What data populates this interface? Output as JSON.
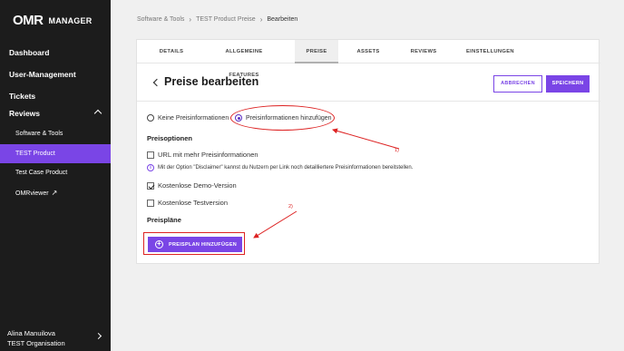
{
  "brand": {
    "mark": "OMR",
    "name": "MANAGER"
  },
  "sidebar": {
    "top_items": [
      {
        "label": "Dashboard"
      },
      {
        "label": "User-Management"
      },
      {
        "label": "Tickets"
      }
    ],
    "section": {
      "label": "Reviews"
    },
    "sub_items": [
      {
        "label": "Software & Tools"
      },
      {
        "label": "TEST Product",
        "active": true
      },
      {
        "label": "Test Case Product"
      },
      {
        "label": "OMRviewer"
      }
    ],
    "user": {
      "name": "Alina Manuilova",
      "org": "TEST Organisation"
    }
  },
  "breadcrumb": {
    "items": [
      "Software & Tools",
      "TEST Product Preise",
      "Bearbeiten"
    ],
    "separator": "›"
  },
  "tabs": [
    {
      "label": "DETAILS"
    },
    {
      "label": "ALLGEMEINE FEATURES"
    },
    {
      "label": "PREISE",
      "active": true
    },
    {
      "label": "ASSETS"
    },
    {
      "label": "REVIEWS"
    },
    {
      "label": "EINSTELLUNGEN"
    }
  ],
  "header": {
    "title": "Preise bearbeiten",
    "cancel_label": "ABBRECHEN",
    "save_label": "SPEICHERN"
  },
  "radio": {
    "option_none": "Keine Preisinformationen",
    "option_add": "Preisinformationen hinzufügen",
    "selected": "option_add"
  },
  "preisoptionen": {
    "heading": "Preisoptionen",
    "url_option": {
      "label": "URL mit mehr Preisinformationen",
      "checked": false
    },
    "info_text": "Mit der Option \"Disclaimer\" kannst du Nutzern per Link noch detailliertere Preisinformationen bereitstellen.",
    "demo_option": {
      "label": "Kostenlose Demo-Version",
      "checked": true
    },
    "trial_option": {
      "label": "Kostenlose Testversion",
      "checked": false
    }
  },
  "preisplaene": {
    "heading": "Preispläne",
    "add_label": "PREISPLAN HINZUFÜGEN"
  },
  "annotations": {
    "one": "1)",
    "two": "2)"
  },
  "colors": {
    "accent": "#7a45e6",
    "sidebar_bg": "#1c1c1c",
    "annotation": "#dd2222"
  },
  "icons": [
    "back-chevron-icon",
    "chevron-up-icon",
    "chevron-right-icon",
    "external-link-icon",
    "info-icon",
    "plus-circle-icon",
    "checkmark-icon"
  ]
}
